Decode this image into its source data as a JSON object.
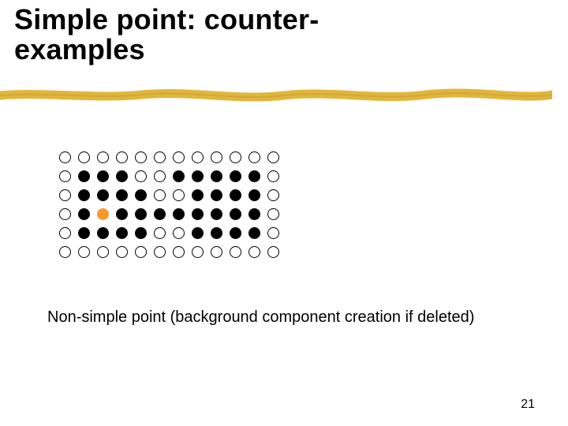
{
  "title_line1": "Simple point: counter-",
  "title_line2": "examples",
  "caption": "Non-simple point (background component creation if deleted)",
  "page_number": "21",
  "grid": {
    "rows": 6,
    "cols": 12,
    "legend": {
      "0": "open",
      "1": "filled",
      "2": "orange-highlight"
    },
    "cells": [
      [
        0,
        0,
        0,
        0,
        0,
        0,
        0,
        0,
        0,
        0,
        0,
        0
      ],
      [
        0,
        1,
        1,
        1,
        0,
        0,
        1,
        1,
        1,
        1,
        1,
        0
      ],
      [
        0,
        1,
        1,
        1,
        1,
        0,
        0,
        1,
        1,
        1,
        1,
        0
      ],
      [
        0,
        1,
        2,
        1,
        1,
        1,
        1,
        1,
        1,
        1,
        1,
        0
      ],
      [
        0,
        1,
        1,
        1,
        1,
        0,
        0,
        1,
        1,
        1,
        1,
        0
      ],
      [
        0,
        0,
        0,
        0,
        0,
        0,
        0,
        0,
        0,
        0,
        0,
        0
      ]
    ]
  }
}
